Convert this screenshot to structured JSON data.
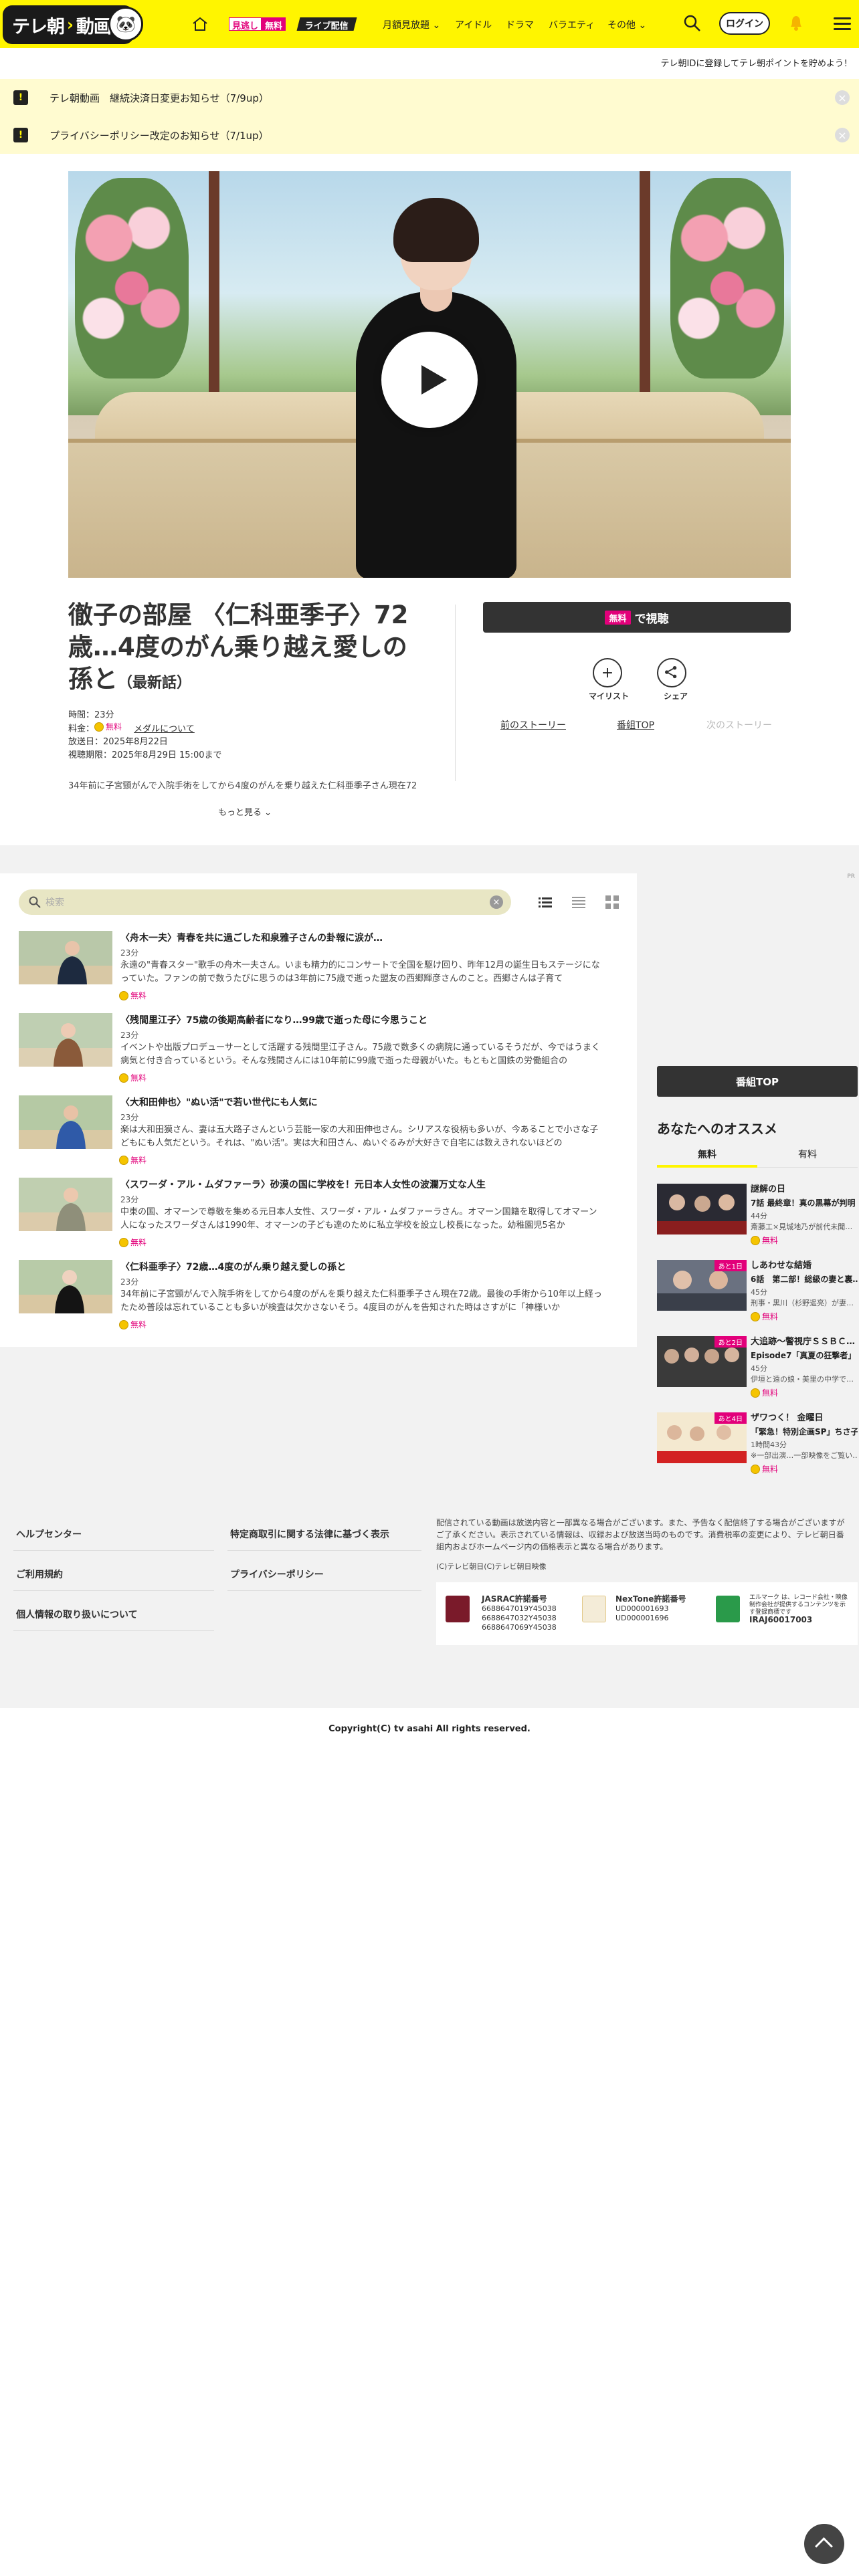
{
  "header": {
    "logo_text": "テレ朝",
    "logo_text2": "動画",
    "mitsu_a": "見逃し",
    "mitsu_b": "無料",
    "live": "ライブ配信",
    "nav": [
      "月額見放題",
      "アイドル",
      "ドラマ",
      "バラエティ",
      "その他"
    ],
    "login": "ログイン",
    "promo": "テレ朝IDに登録してテレ朝ポイントを貯めよう！"
  },
  "notices": [
    "テレ朝動画　継続決済日変更お知らせ（7/9up）",
    "プライバシーポリシー改定のお知らせ（7/1up）"
  ],
  "episode": {
    "title_main": "徹子の部屋 〈仁科亜季子〉72歳…4度のがん乗り越え愛しの孫と",
    "title_tag": "（最新話）",
    "time": "時間：23分",
    "fee_label": "料金：",
    "fee_free": "無料",
    "medal_link": "メダルについて",
    "aired": "放送日：2025年8月22日",
    "expiry": "視聴期限：2025年8月29日 15:00まで",
    "desc": "34年前に子宮頸がんで入院手術をしてから4度のがんを乗り越えた仁科亜季子さん現在72",
    "more": "もっと見る",
    "watch_free": "無料",
    "watch_label": "で視聴",
    "mylist": "マイリスト",
    "share": "シェア",
    "prev": "前のストーリー",
    "top": "番組TOP",
    "next": "次のストーリー"
  },
  "list": {
    "search_placeholder": "検索",
    "ad": "PR",
    "items": [
      {
        "title": "〈舟木一夫〉青春を共に過ごした和泉雅子さんの卦報に涙が…",
        "dur": "23分",
        "desc": "永遠の\"青春スター\"歌手の舟木一夫さん。いまも精力的にコンサートで全国を駆け回り、昨年12月の誕生日もステージになっていた。ファンの前で数うたびに思うのは3年前に75歳で逝った盟友の西郷輝彦さんのこと。西郷さんは子育て",
        "free": "無料"
      },
      {
        "title": "〈残間里江子〉75歳の後期高齢者になり…99歳で逝った母に今思うこと",
        "dur": "23分",
        "desc": "イベントや出版プロデューサーとして活躍する残間里江子さん。75歳で数多くの病院に通っているそうだが、今ではうまく病気と付き合っているという。そんな残間さんには10年前に99歳で逝った母親がいた。もともと国鉄の労働組合の",
        "free": "無料"
      },
      {
        "title": "〈大和田伸也〉\"ぬい活\"で若い世代にも人気に",
        "dur": "23分",
        "desc": "楽は大和田獏さん、妻は五大路子さんという芸能一家の大和田伸也さん。シリアスな役柄も多いが、今あることで小さな子どもにも人気だという。それは、\"ぬい活\"。実は大和田さん、ぬいぐるみが大好きで自宅には数えきれないほどの",
        "free": "無料"
      },
      {
        "title": "〈スワーダ・アル・ムダファーラ〉砂漠の国に学校を！元日本人女性の波瀾万丈な人生",
        "dur": "23分",
        "desc": "中東の国、オマーンで尊敬を集める元日本人女性、スワーダ・アル・ムダファーラさん。オマーン国籍を取得してオマーン人になったスワーダさんは1990年、オマーンの子ども達のために私立学校を設立し校長になった。幼稚園児5名か",
        "free": "無料"
      },
      {
        "title": "〈仁科亜季子〉72歳…4度のがん乗り越え愛しの孫と",
        "dur": "23分",
        "desc": "34年前に子宮頸がんで入院手術をしてから4度のがんを乗り越えた仁科亜季子さん現在72歳。最後の手術から10年以上経ったため普段は忘れていることも多いが検査は欠かさないそう。4度目のがんを告知された時はさすがに「神様いか",
        "free": "無料"
      }
    ]
  },
  "sidebar": {
    "program_top": "番組TOP",
    "heading": "あなたへのオススメ",
    "tab_free": "無料",
    "tab_paid": "有料",
    "items": [
      {
        "title": "謎解の日",
        "sub": "7話 最終章！真の黒幕が判明",
        "dur": "44分",
        "desc": "斎藤工×見城地乃が前代未聞…",
        "free": "無料",
        "badge": ""
      },
      {
        "title": "しあわせな結婚",
        "sub": "6話　第二部！総級の妻と裏…",
        "dur": "45分",
        "desc": "刑事・黒川（杉野遥亮）が妻…",
        "free": "無料",
        "badge": "あと1日"
      },
      {
        "title": "大追跡～警視庁ＳＳＢＣ…",
        "sub": "Episode7「真夏の狂撃者」",
        "dur": "45分",
        "desc": "伊垣と遠の娘・美里の中学で…",
        "free": "無料",
        "badge": "あと2日"
      },
      {
        "title": "ザワつく！ 金曜日",
        "sub": "「緊急！特別企画SP」ちさ子…",
        "dur": "1時間43分",
        "desc": "※一部出演…一部映像をご覧い…",
        "free": "無料",
        "badge": "あと4日"
      }
    ]
  },
  "footer": {
    "links_left": [
      "ヘルプセンター",
      "ご利用規約",
      "個人情報の取り扱いについて"
    ],
    "links_right": [
      "特定商取引に関する法律に基づく表示",
      "プライバシーポリシー"
    ],
    "note": "配信されている動画は放送内容と一部異なる場合がございます。また、予告なく配信終了する場合がございますがご了承ください。表示されている情報は、収録および放送当時のものです。消費税率の変更により、テレビ朝日番組内およびホームページ内の価格表示と異なる場合があります。",
    "small": "(C)テレビ朝日(C)テレビ朝日映像",
    "jasrac_title": "JASRAC許諾番号",
    "jasrac_nums": [
      "6688647019Y45038",
      "6688647032Y45038",
      "6688647069Y45038"
    ],
    "nextone_title": "NexTone許諾番号",
    "nextone_nums": [
      "UD000001693",
      "UD000001696"
    ],
    "ire_text": "エルマーク は、レコード会社・映像制作会社が提供するコンテンツを示す登録商標です",
    "ire_code": "IRAJ60017003",
    "copyright": "Copyright(C) tv asahi All rights reserved."
  }
}
